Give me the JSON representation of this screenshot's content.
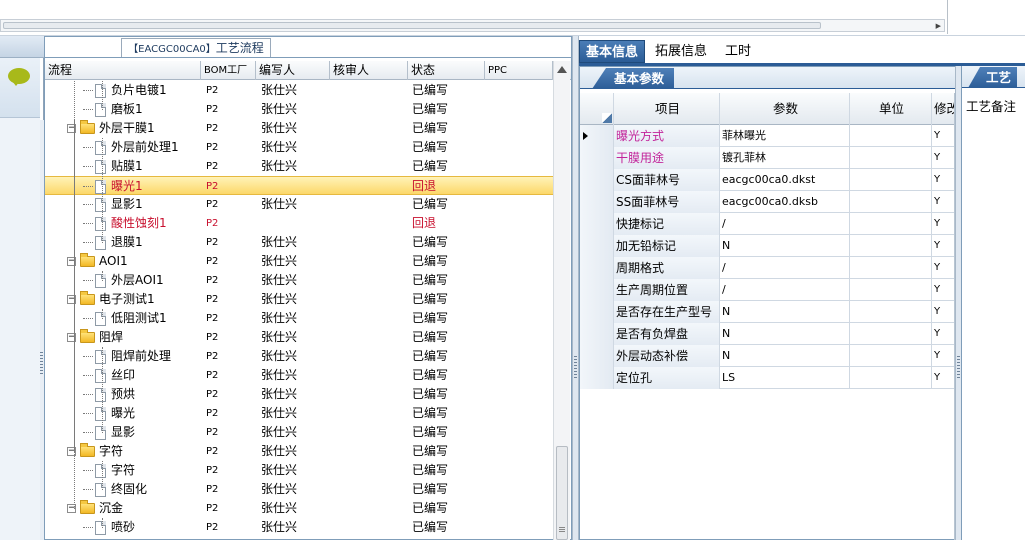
{
  "tree": {
    "caption_code": "【EACGC00CA0】",
    "caption_title": "工艺流程",
    "columns": [
      "流程",
      "BOM工厂",
      "编写人",
      "核审人",
      "状态",
      "PPC"
    ],
    "rows": [
      {
        "name": "负片电镀1",
        "level": 1,
        "type": "doc",
        "bom": "P2",
        "writer": "张仕兴",
        "reviewer": "",
        "status": "已编写",
        "ppc": ""
      },
      {
        "name": "磨板1",
        "level": 1,
        "type": "doc",
        "bom": "P2",
        "writer": "张仕兴",
        "reviewer": "",
        "status": "已编写",
        "ppc": ""
      },
      {
        "name": "外层干膜1",
        "level": 0,
        "type": "folder",
        "bom": "P2",
        "writer": "张仕兴",
        "reviewer": "",
        "status": "已编写",
        "ppc": ""
      },
      {
        "name": "外层前处理1",
        "level": 1,
        "type": "doc",
        "bom": "P2",
        "writer": "张仕兴",
        "reviewer": "",
        "status": "已编写",
        "ppc": ""
      },
      {
        "name": "贴膜1",
        "level": 1,
        "type": "doc",
        "bom": "P2",
        "writer": "张仕兴",
        "reviewer": "",
        "status": "已编写",
        "ppc": ""
      },
      {
        "name": "曝光1",
        "level": 1,
        "type": "doc",
        "bom": "P2",
        "writer": "",
        "reviewer": "",
        "status": "回退",
        "ppc": "",
        "red": true,
        "selected": true
      },
      {
        "name": "显影1",
        "level": 1,
        "type": "doc",
        "bom": "P2",
        "writer": "张仕兴",
        "reviewer": "",
        "status": "已编写",
        "ppc": ""
      },
      {
        "name": "酸性蚀刻1",
        "level": 1,
        "type": "doc",
        "bom": "P2",
        "writer": "",
        "reviewer": "",
        "status": "回退",
        "ppc": "",
        "red": true
      },
      {
        "name": "退膜1",
        "level": 1,
        "type": "doc",
        "bom": "P2",
        "writer": "张仕兴",
        "reviewer": "",
        "status": "已编写",
        "ppc": ""
      },
      {
        "name": "AOI1",
        "level": 0,
        "type": "folder",
        "bom": "P2",
        "writer": "张仕兴",
        "reviewer": "",
        "status": "已编写",
        "ppc": ""
      },
      {
        "name": "外层AOI1",
        "level": 1,
        "type": "doc",
        "bom": "P2",
        "writer": "张仕兴",
        "reviewer": "",
        "status": "已编写",
        "ppc": ""
      },
      {
        "name": "电子测试1",
        "level": 0,
        "type": "folder",
        "bom": "P2",
        "writer": "张仕兴",
        "reviewer": "",
        "status": "已编写",
        "ppc": ""
      },
      {
        "name": "低阻测试1",
        "level": 1,
        "type": "doc",
        "bom": "P2",
        "writer": "张仕兴",
        "reviewer": "",
        "status": "已编写",
        "ppc": ""
      },
      {
        "name": "阻焊",
        "level": 0,
        "type": "folder",
        "bom": "P2",
        "writer": "张仕兴",
        "reviewer": "",
        "status": "已编写",
        "ppc": ""
      },
      {
        "name": "阻焊前处理",
        "level": 1,
        "type": "doc",
        "bom": "P2",
        "writer": "张仕兴",
        "reviewer": "",
        "status": "已编写",
        "ppc": ""
      },
      {
        "name": "丝印",
        "level": 1,
        "type": "doc",
        "bom": "P2",
        "writer": "张仕兴",
        "reviewer": "",
        "status": "已编写",
        "ppc": ""
      },
      {
        "name": "预烘",
        "level": 1,
        "type": "doc",
        "bom": "P2",
        "writer": "张仕兴",
        "reviewer": "",
        "status": "已编写",
        "ppc": ""
      },
      {
        "name": "曝光",
        "level": 1,
        "type": "doc",
        "bom": "P2",
        "writer": "张仕兴",
        "reviewer": "",
        "status": "已编写",
        "ppc": ""
      },
      {
        "name": "显影",
        "level": 1,
        "type": "doc",
        "bom": "P2",
        "writer": "张仕兴",
        "reviewer": "",
        "status": "已编写",
        "ppc": ""
      },
      {
        "name": "字符",
        "level": 0,
        "type": "folder",
        "bom": "P2",
        "writer": "张仕兴",
        "reviewer": "",
        "status": "已编写",
        "ppc": ""
      },
      {
        "name": "字符",
        "level": 1,
        "type": "doc",
        "bom": "P2",
        "writer": "张仕兴",
        "reviewer": "",
        "status": "已编写",
        "ppc": ""
      },
      {
        "name": "终固化",
        "level": 1,
        "type": "doc",
        "bom": "P2",
        "writer": "张仕兴",
        "reviewer": "",
        "status": "已编写",
        "ppc": ""
      },
      {
        "name": "沉金",
        "level": 0,
        "type": "folder",
        "bom": "P2",
        "writer": "张仕兴",
        "reviewer": "",
        "status": "已编写",
        "ppc": ""
      },
      {
        "name": "喷砂",
        "level": 1,
        "type": "doc",
        "bom": "P2",
        "writer": "张仕兴",
        "reviewer": "",
        "status": "已编写",
        "ppc": ""
      }
    ]
  },
  "tabs": [
    {
      "label": "基本信息",
      "active": true
    },
    {
      "label": "拓展信息",
      "active": false
    },
    {
      "label": "工时",
      "active": false
    }
  ],
  "params": {
    "subtab": "基本参数",
    "columns": [
      "项目",
      "参数",
      "单位",
      "修改"
    ],
    "rows": [
      {
        "item": "曝光方式",
        "value": "菲林曝光",
        "unit": "",
        "mod": "Y",
        "pink": true,
        "current": true
      },
      {
        "item": "干膜用途",
        "value": "镀孔菲林",
        "unit": "",
        "mod": "Y",
        "pink": true
      },
      {
        "item": "CS面菲林号",
        "value": "eacgc00ca0.dkst",
        "unit": "",
        "mod": "Y"
      },
      {
        "item": "SS面菲林号",
        "value": "eacgc00ca0.dksb",
        "unit": "",
        "mod": "Y"
      },
      {
        "item": "快捷标记",
        "value": "/",
        "unit": "",
        "mod": "Y"
      },
      {
        "item": "加无铅标记",
        "value": "N",
        "unit": "",
        "mod": "Y"
      },
      {
        "item": "周期格式",
        "value": "/",
        "unit": "",
        "mod": "Y"
      },
      {
        "item": "生产周期位置",
        "value": "/",
        "unit": "",
        "mod": "Y"
      },
      {
        "item": "是否存在生产型号",
        "value": "N",
        "unit": "",
        "mod": "Y"
      },
      {
        "item": "是否有负焊盘",
        "value": "N",
        "unit": "",
        "mod": "Y"
      },
      {
        "item": "外层动态补偿",
        "value": "N",
        "unit": "",
        "mod": "Y"
      },
      {
        "item": "定位孔",
        "value": "LS",
        "unit": "",
        "mod": "Y"
      }
    ]
  },
  "notes": {
    "tab": "工艺",
    "label": "工艺备注"
  }
}
